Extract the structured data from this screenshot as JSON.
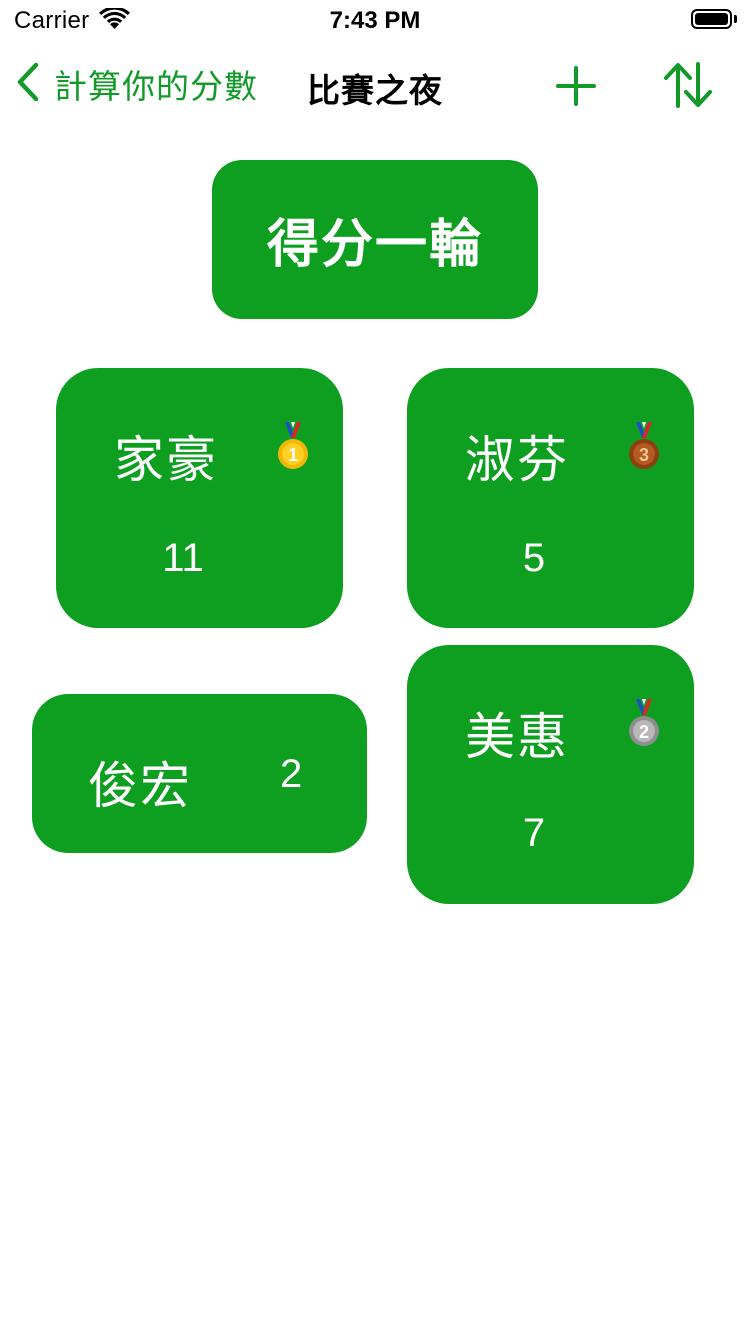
{
  "status_bar": {
    "carrier": "Carrier",
    "time": "7:43 PM"
  },
  "nav": {
    "back_label": "計算你的分數",
    "title": "比賽之夜",
    "accent_color": "#129a29",
    "icons": {
      "back": "chevron-left-icon",
      "add": "plus-icon",
      "sort": "sort-arrows-icon"
    }
  },
  "round_button": {
    "label": "得分一輪",
    "color": "#0e9f21"
  },
  "players": [
    {
      "name": "家豪",
      "score": "11",
      "medal": "gold-medal-1"
    },
    {
      "name": "淑芬",
      "score": "5",
      "medal": "bronze-medal-3"
    },
    {
      "name": "俊宏",
      "score": "2",
      "medal": null
    },
    {
      "name": "美惠",
      "score": "7",
      "medal": "silver-medal-2"
    }
  ]
}
